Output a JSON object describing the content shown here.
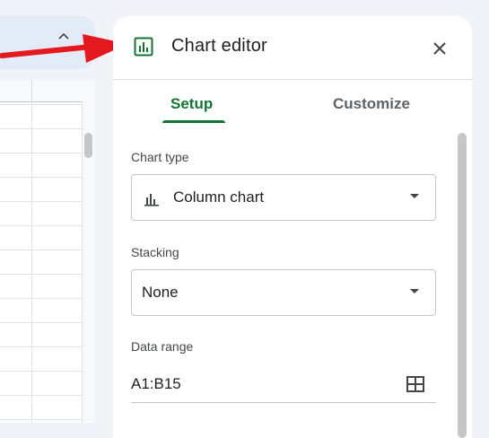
{
  "editor": {
    "title": "Chart editor",
    "tabs": [
      {
        "label": "Setup",
        "active": true
      },
      {
        "label": "Customize",
        "active": false
      }
    ],
    "chart_type": {
      "label": "Chart type",
      "value": "Column chart",
      "icon": "column-chart-icon"
    },
    "stacking": {
      "label": "Stacking",
      "value": "None"
    },
    "data_range": {
      "label": "Data range",
      "value": "A1:B15"
    }
  },
  "colors": {
    "accent": "#137333",
    "arrow": "#e3191f",
    "panel_bg": "#ffffff",
    "page_bg": "#f0f4f9"
  }
}
